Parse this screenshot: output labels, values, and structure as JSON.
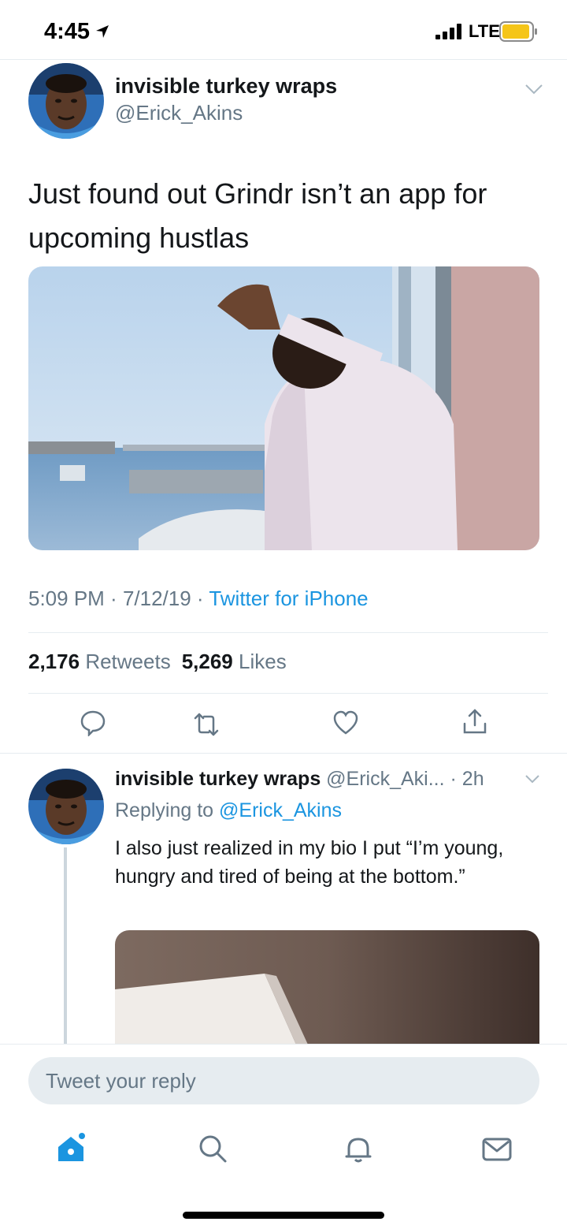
{
  "status_bar": {
    "time": "4:45",
    "network": "LTE"
  },
  "tweet": {
    "author_name": "invisible turkey wraps",
    "author_handle": "@Erick_Akins",
    "text": "Just found out Grindr isn’t an app for upcoming hustlas",
    "time": "5:09 PM",
    "date": "7/12/19",
    "source": "Twitter for iPhone",
    "retweets_count": "2,176",
    "retweets_label": "Retweets",
    "likes_count": "5,269",
    "likes_label": "Likes"
  },
  "reply": {
    "author_name": "invisible turkey wraps",
    "author_handle": "@Erick_Aki...",
    "time_ago": "2h",
    "replying_prefix": "Replying to",
    "replying_mention": "@Erick_Akins",
    "text": "I also just realized in my bio I put “I’m young, hungry and tired of being at the bottom.”"
  },
  "composer": {
    "placeholder": "Tweet your reply"
  },
  "icons": {
    "status": [
      "location-arrow-icon",
      "signal-bars-icon",
      "battery-icon"
    ],
    "actions": [
      "reply-icon",
      "retweet-icon",
      "like-icon",
      "share-icon"
    ],
    "nav": [
      "home-icon",
      "search-icon",
      "notifications-icon",
      "messages-icon"
    ]
  },
  "colors": {
    "accent": "#1b95e0",
    "secondary_text": "#657786",
    "divider": "#e6ecf0",
    "battery": "#f5c518"
  }
}
